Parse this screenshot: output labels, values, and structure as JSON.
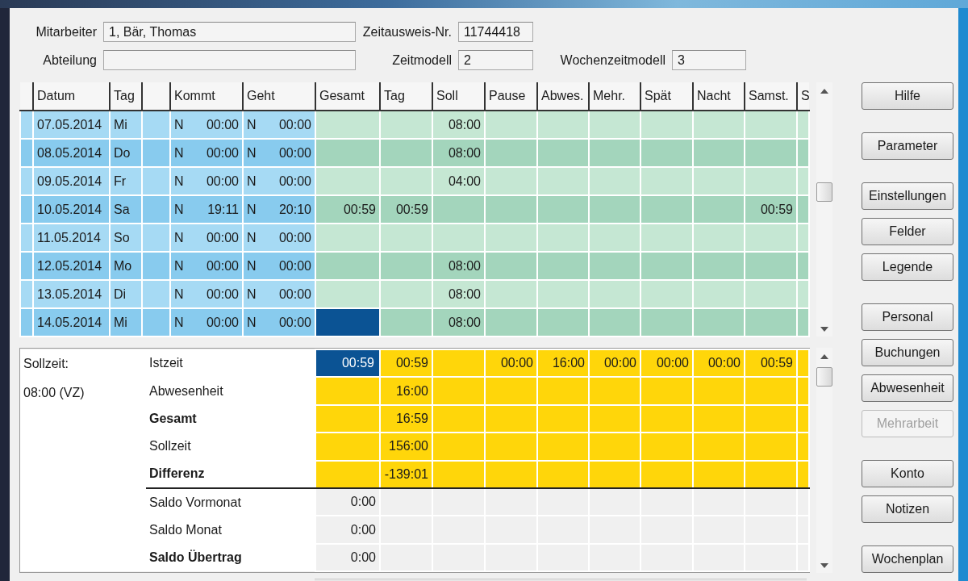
{
  "header_fields": [
    [
      {
        "label": "Mitarbeiter",
        "value": "1, Bär, Thomas"
      },
      {
        "label": "Zeitausweis-Nr.",
        "value": "11744418"
      }
    ],
    [
      {
        "label": "Abteilung"
      },
      {
        "label": "Zeitmodell",
        "value": "2"
      },
      {
        "label": "Wochenzeitmodell",
        "value": "3"
      }
    ]
  ],
  "grid": {
    "columns": [
      {
        "kind": "booking",
        "label": "Datum"
      },
      {
        "kind": "booking",
        "label": "Tag"
      },
      {
        "kind": "booking"
      },
      {
        "kind": "booking",
        "label": "Kommt"
      },
      {
        "kind": "booking",
        "label": "Geht"
      },
      {
        "kind": "time",
        "label": "Gesamt"
      },
      {
        "kind": "time",
        "label": "Tag"
      },
      {
        "kind": "time",
        "label": "Soll"
      },
      {
        "kind": "time",
        "label": "Pause"
      },
      {
        "kind": "time",
        "label": "Abwes."
      },
      {
        "kind": "time",
        "label": "Mehr."
      },
      {
        "kind": "time",
        "label": "Spät"
      },
      {
        "kind": "time",
        "label": "Nacht"
      },
      {
        "kind": "time",
        "label": "Samst."
      },
      {
        "kind": "time",
        "label": "S"
      }
    ],
    "rows": [
      {
        "date": "07.05.2014",
        "day": "Mi",
        "in_flag": "N",
        "in": "00:00",
        "out_flag": "N",
        "out": "00:00",
        "selected": false,
        "target": "08:00"
      },
      {
        "date": "08.05.2014",
        "day": "Do",
        "in_flag": "N",
        "in": "00:00",
        "out_flag": "N",
        "out": "00:00",
        "selected": false,
        "target": "08:00"
      },
      {
        "date": "09.05.2014",
        "day": "Fr",
        "in_flag": "N",
        "in": "00:00",
        "out_flag": "N",
        "out": "00:00",
        "selected": false,
        "target": "04:00"
      },
      {
        "date": "10.05.2014",
        "day": "Sa",
        "in_flag": "N",
        "in": "19:11",
        "out_flag": "N",
        "out": "20:10",
        "selected": false,
        "total": "00:59",
        "day_total": "00:59",
        "saturday": "00:59"
      },
      {
        "date": "11.05.2014",
        "day": "So",
        "in_flag": "N",
        "in": "00:00",
        "out_flag": "N",
        "out": "00:00",
        "selected": false
      },
      {
        "date": "12.05.2014",
        "day": "Mo",
        "in_flag": "N",
        "in": "00:00",
        "out_flag": "N",
        "out": "00:00",
        "selected": false,
        "target": "08:00"
      },
      {
        "date": "13.05.2014",
        "day": "Di",
        "in_flag": "N",
        "in": "00:00",
        "out_flag": "N",
        "out": "00:00",
        "selected": false,
        "target": "08:00"
      },
      {
        "date": "14.05.2014",
        "day": "Mi",
        "in_flag": "N",
        "in": "00:00",
        "out_flag": "N",
        "out": "00:00",
        "selected": true,
        "target": "08:00"
      }
    ]
  },
  "summary": {
    "target_label": "Sollzeit:",
    "target_value": "08:00 (VZ)",
    "rows": [
      {
        "kind": "total",
        "label": "Istzeit",
        "emphasis": false,
        "selected": true,
        "total": "00:59",
        "day_total": "00:59",
        "break": "00:00",
        "absence": "16:00",
        "overtime": "00:00",
        "late": "00:00",
        "night": "00:00",
        "saturday": "00:59"
      },
      {
        "kind": "total",
        "label": "Abwesenheit",
        "emphasis": false,
        "selected": false,
        "day_total": "16:00"
      },
      {
        "kind": "total",
        "label": "Gesamt",
        "emphasis": true,
        "selected": false,
        "day_total": "16:59"
      },
      {
        "kind": "total",
        "label": "Sollzeit",
        "emphasis": false,
        "selected": false,
        "day_total": "156:00"
      },
      {
        "kind": "total",
        "label": "Differenz",
        "emphasis": true,
        "selected": false,
        "day_total": "-139:01"
      },
      {
        "kind": "balance",
        "label": "Saldo Vormonat",
        "emphasis": false,
        "selected": false,
        "total": "0:00"
      },
      {
        "kind": "balance",
        "label": "Saldo Monat",
        "emphasis": false,
        "selected": false,
        "total": "0:00"
      },
      {
        "kind": "balance",
        "label": "Saldo Übertrag",
        "emphasis": true,
        "selected": false,
        "total": "0:00"
      }
    ]
  },
  "button_groups": [
    [
      {
        "label": "Hilfe",
        "disabled": false
      }
    ],
    [
      {
        "label": "Parameter",
        "disabled": false
      }
    ],
    [
      {
        "label": "Einstellungen",
        "disabled": false
      },
      {
        "label": "Felder",
        "disabled": false
      },
      {
        "label": "Legende",
        "disabled": false
      }
    ],
    [
      {
        "label": "Personal",
        "disabled": false
      },
      {
        "label": "Buchungen",
        "disabled": false
      },
      {
        "label": "Abwesenheit",
        "disabled": false
      },
      {
        "label": "Mehrarbeit",
        "disabled": true
      }
    ],
    [
      {
        "label": "Konto",
        "disabled": false
      },
      {
        "label": "Notizen",
        "disabled": false
      }
    ],
    [
      {
        "label": "Wochenplan",
        "disabled": false
      }
    ]
  ]
}
